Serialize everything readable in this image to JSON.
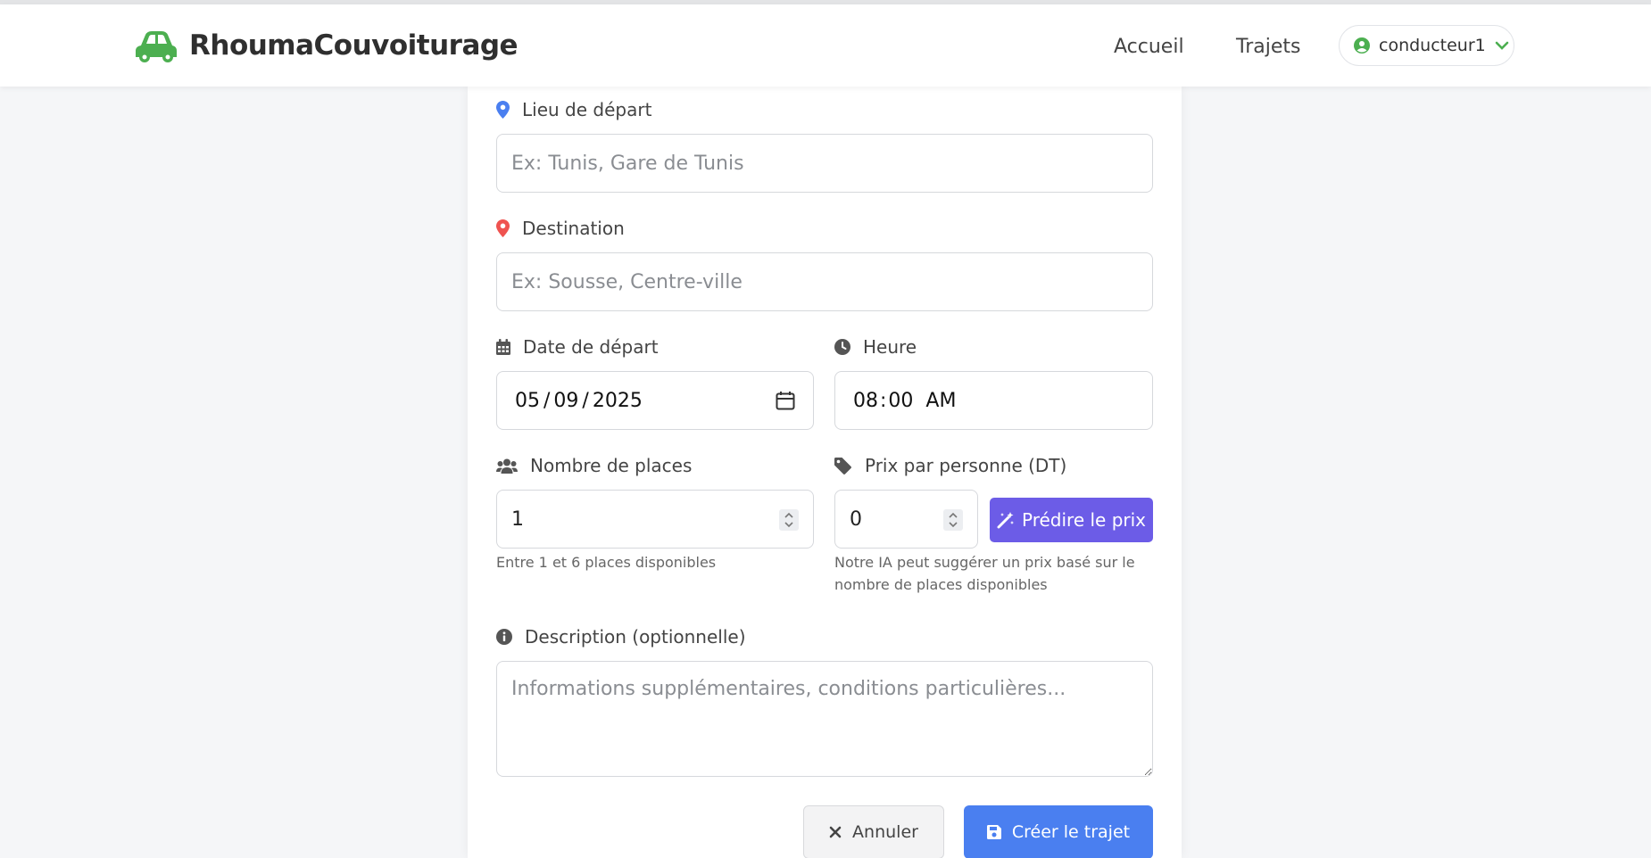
{
  "brand": {
    "name": "RhoumaCouvoiturage",
    "color": "#4caf50"
  },
  "nav": {
    "home": "Accueil",
    "trips": "Trajets",
    "user": "conducteur1"
  },
  "form": {
    "departure": {
      "label": "Lieu de départ",
      "placeholder": "Ex: Tunis, Gare de Tunis",
      "icon": "map-marker-icon",
      "icon_color": "#4a7ff0"
    },
    "destination": {
      "label": "Destination",
      "placeholder": "Ex: Sousse, Centre-ville",
      "icon": "map-marker-icon",
      "icon_color": "#ef5350"
    },
    "date": {
      "label": "Date de départ",
      "day": "05",
      "month": "09",
      "year": "2025"
    },
    "time": {
      "label": "Heure",
      "hours": "08",
      "minutes": "00",
      "ampm": "AM"
    },
    "seats": {
      "label": "Nombre de places",
      "value": "1",
      "help": "Entre 1 et 6 places disponibles"
    },
    "price": {
      "label": "Prix par personne (DT)",
      "value": "0",
      "predict_label": "Prédire le prix",
      "help_line1": "Notre IA peut suggérer un prix basé sur le",
      "help_line2": "nombre de places disponibles"
    },
    "description": {
      "label": "Description (optionnelle)",
      "placeholder": "Informations supplémentaires, conditions particulières..."
    },
    "cancel_label": "Annuler",
    "submit_label": "Créer le trajet"
  },
  "colors": {
    "primary": "#4a7ff0",
    "predict": "#6c5ce7",
    "online": "#4caf50"
  }
}
